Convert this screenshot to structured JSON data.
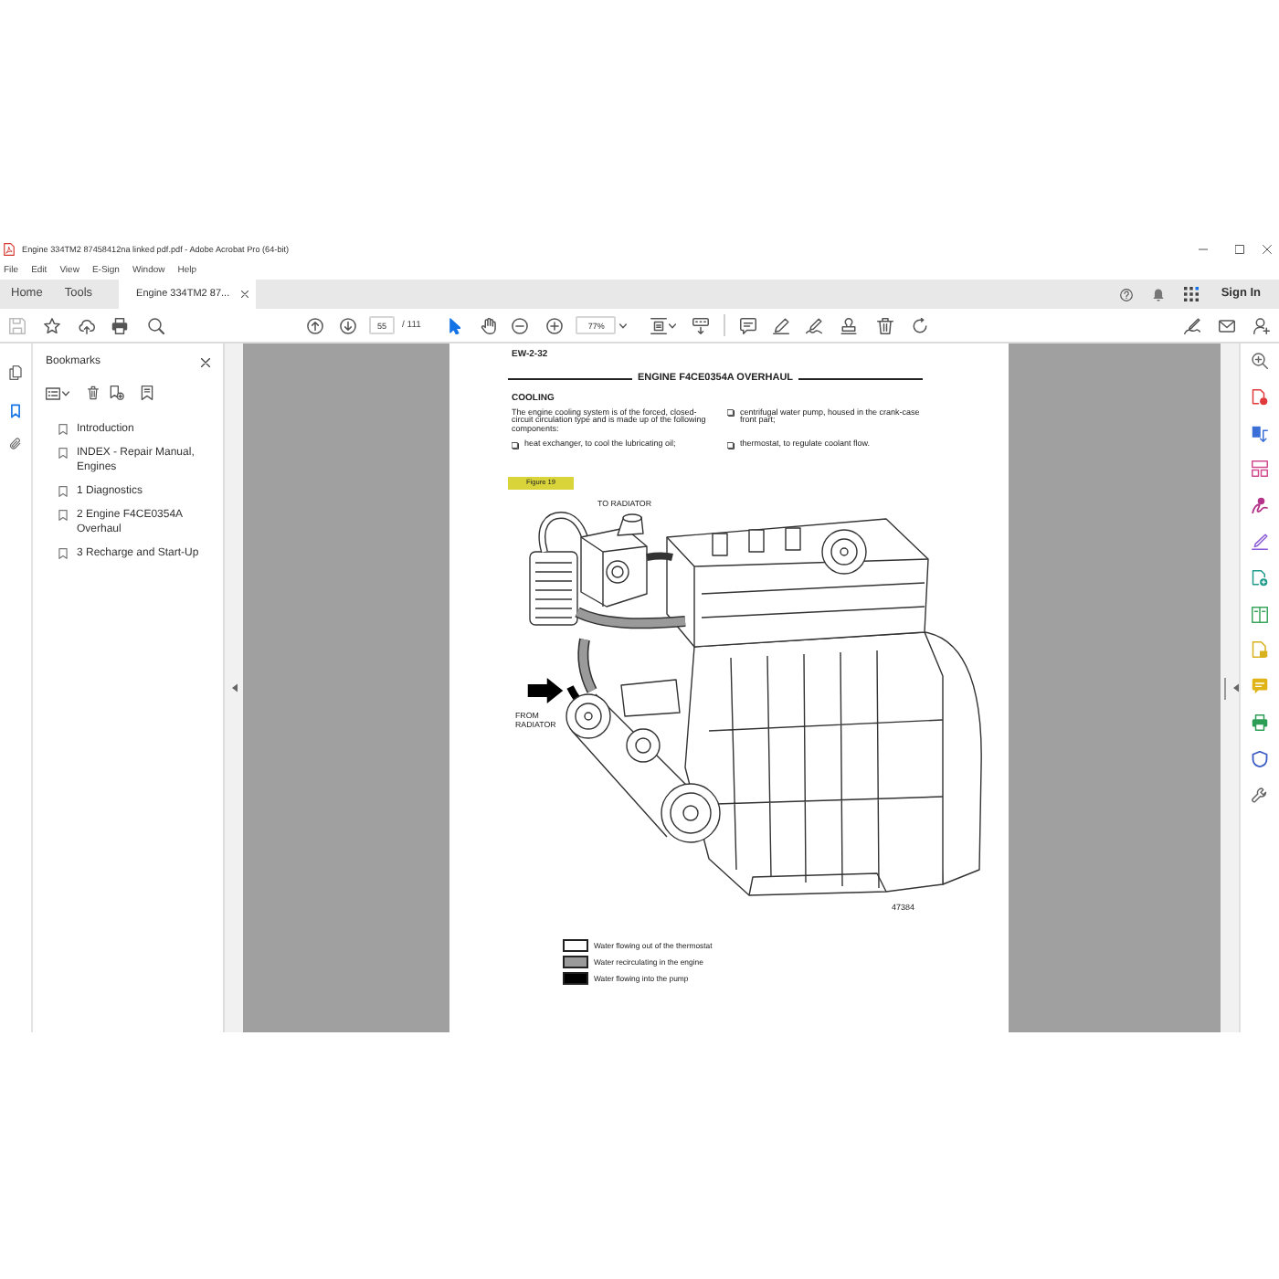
{
  "window": {
    "title": "Engine 334TM2 87458412na linked pdf.pdf - Adobe Acrobat Pro (64-bit)"
  },
  "menu_bar": [
    "File",
    "Edit",
    "View",
    "E-Sign",
    "Window",
    "Help"
  ],
  "tabs": [
    {
      "label": "Home",
      "selected": false,
      "closable": false
    },
    {
      "label": "Tools",
      "selected": false,
      "closable": false
    },
    {
      "label": "Engine 334TM2 87...",
      "selected": true,
      "closable": true
    }
  ],
  "account": {
    "sign_in": "Sign In"
  },
  "toolbar": {
    "tools": [
      {
        "kind": "select",
        "selected": true
      },
      {
        "kind": "hand",
        "selected": false
      }
    ],
    "page": "55",
    "page_count": "/ 111",
    "zoom": "77%"
  },
  "left_rail": [
    {
      "kind": "pages",
      "selected": false
    },
    {
      "kind": "bookmarks",
      "selected": true
    },
    {
      "kind": "attachments",
      "selected": false
    }
  ],
  "bookmarks": {
    "title": "Bookmarks",
    "items": [
      "Introduction",
      "INDEX - Repair Manual, Engines",
      "1 Diagnostics",
      "2 Engine F4CE0354A Overhaul",
      "3 Recharge and Start-Up"
    ]
  },
  "document": {
    "page_header": "EW-2-32",
    "section_title": "ENGINE F4CE0354A OVERHAUL",
    "heading": "COOLING",
    "intro": "The engine cooling system is of the forced, closed-circuit circulation type and is made up of the following components:",
    "components": [
      "heat exchanger, to cool the lubricating oil;",
      "centrifugal water pump, housed in the crank-case front part;",
      "thermostat, to regulate coolant flow."
    ],
    "figure": {
      "label": "Figure 19",
      "callouts": [
        {
          "kind": "outlet",
          "text": "TO RADIATOR"
        },
        {
          "kind": "inlet",
          "text": "FROM RADIATOR"
        }
      ],
      "code": "47384"
    },
    "legend": [
      {
        "color": "#ffffff",
        "text": "Water flowing out of the thermostat"
      },
      {
        "color": "#9a9a9a",
        "text": "Water recirculating in the engine"
      },
      {
        "color": "#000000",
        "text": "Water flowing into the pump"
      }
    ]
  }
}
